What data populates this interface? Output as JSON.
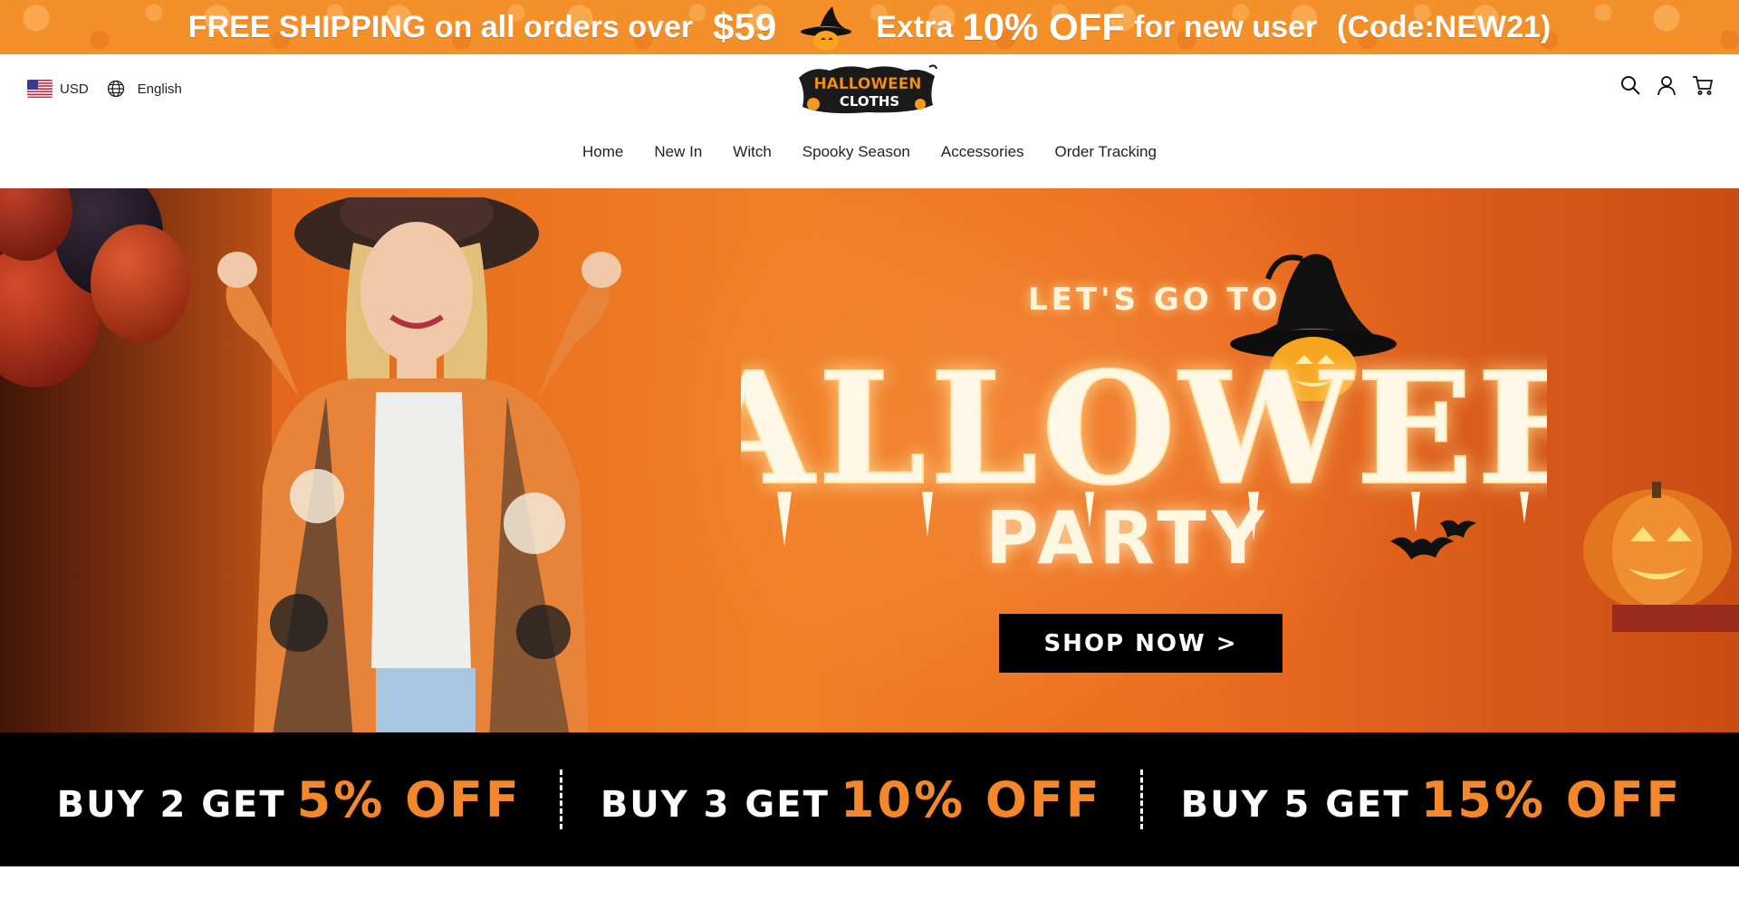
{
  "promo": {
    "part1": "FREE SHIPPING on all orders over",
    "price": "$59",
    "part2_prefix": "Extra",
    "percent": "10% OFF",
    "part2_suffix": "for new user",
    "code": "(Code:NEW21)"
  },
  "header": {
    "currency": "USD",
    "language": "English",
    "logo_line1": "HALLOWEEN",
    "logo_line2": "CLOTHS",
    "icons": [
      "search-icon",
      "account-icon",
      "cart-icon"
    ]
  },
  "nav": {
    "items": [
      "Home",
      "New In",
      "Witch",
      "Spooky Season",
      "Accessories",
      "Order Tracking"
    ]
  },
  "hero": {
    "subtitle": "LET'S GO TO",
    "title": "HALLOWEEN",
    "title2": "PARTY",
    "cta": "SHOP NOW >"
  },
  "deals": [
    {
      "label": "BUY 2 GET",
      "amount": "5% OFF"
    },
    {
      "label": "BUY 3 GET",
      "amount": "10% OFF"
    },
    {
      "label": "BUY 5 GET",
      "amount": "15% OFF"
    }
  ],
  "colors": {
    "promo_bg": "#f3902a",
    "accent_orange": "#f4872a",
    "hero_orange": "#e66c1c",
    "black": "#000000"
  }
}
